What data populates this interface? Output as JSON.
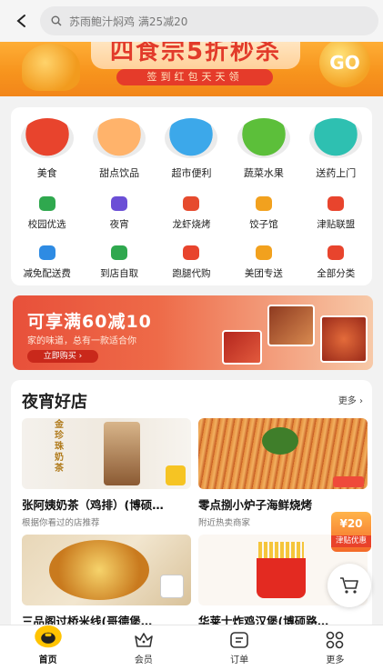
{
  "search": {
    "placeholder": "苏雨鲍汁焖鸡 满25减20"
  },
  "banner": {
    "headline": "四食宗5折秒杀",
    "subline": "签到红包天天领",
    "go_label": "GO"
  },
  "categories_big": [
    {
      "label": "美食",
      "color": "#e8442d"
    },
    {
      "label": "甜点饮品",
      "color": "#ffb36b"
    },
    {
      "label": "超市便利",
      "color": "#3ca8ea"
    },
    {
      "label": "蔬菜水果",
      "color": "#5cbf3a"
    },
    {
      "label": "送药上门",
      "color": "#2ec0b1"
    }
  ],
  "categories_row2": [
    {
      "label": "校园优选",
      "color": "#2fa84e"
    },
    {
      "label": "夜宵",
      "color": "#6b4fd6"
    },
    {
      "label": "龙虾烧烤",
      "color": "#e64b2e"
    },
    {
      "label": "饺子馆",
      "color": "#f2a11e"
    },
    {
      "label": "津贴联盟",
      "color": "#e8442d"
    }
  ],
  "categories_row3": [
    {
      "label": "减免配送费",
      "color": "#2e8be3"
    },
    {
      "label": "到店自取",
      "color": "#2fa84e"
    },
    {
      "label": "跑腿代购",
      "color": "#e8442d"
    },
    {
      "label": "美团专送",
      "color": "#f2a11e"
    },
    {
      "label": "全部分类",
      "color": "#e8442d"
    }
  ],
  "promo": {
    "title": "可享满60减10",
    "subtitle": "家的味道，总有一款适合你",
    "button": "立即购买 ›"
  },
  "stores": {
    "title": "夜宵好店",
    "more": "更多 ›",
    "items": [
      {
        "name": "张阿姨奶茶（鸡排）(博硕…",
        "desc": "根据你看过的店推荐",
        "img_text": "金珍珠奶茶"
      },
      {
        "name": "零点捌小炉子海鲜烧烤",
        "desc": "附近热卖商家",
        "img_text": ""
      },
      {
        "name": "三品阁过桥米线(哥德堡…",
        "desc": "",
        "img_text": ""
      },
      {
        "name": "华莱士炸鸡汉堡(博硕路…",
        "desc": "",
        "img_text": ""
      }
    ]
  },
  "coupon": {
    "amount": "¥20",
    "label": "津贴优惠"
  },
  "tabs": [
    {
      "label": "首页",
      "icon": "home-icon"
    },
    {
      "label": "会员",
      "icon": "crown-icon"
    },
    {
      "label": "订单",
      "icon": "order-icon"
    },
    {
      "label": "更多",
      "icon": "grid-icon"
    }
  ]
}
